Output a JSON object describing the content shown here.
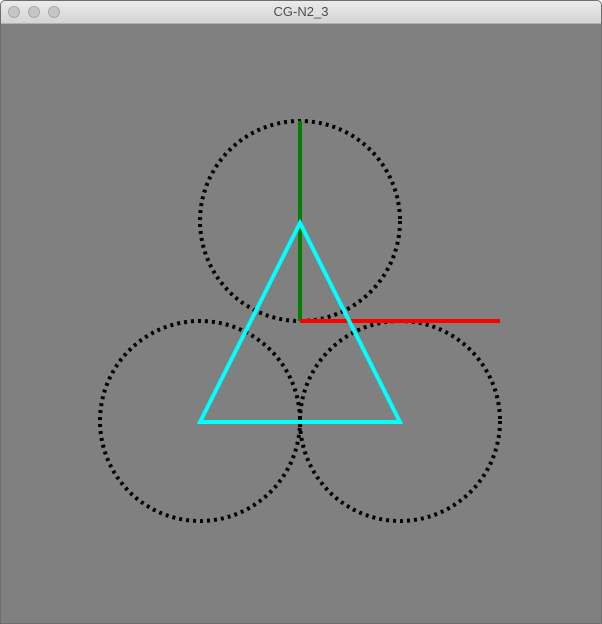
{
  "window": {
    "title": "CG-N2_3"
  },
  "colors": {
    "background": "#808080",
    "circle_dots": "#000000",
    "y_axis": "#007f00",
    "x_axis": "#ff0000",
    "triangle": "#00ffff"
  },
  "icons": {
    "close": "circle",
    "minimize": "circle",
    "zoom": "circle"
  }
}
